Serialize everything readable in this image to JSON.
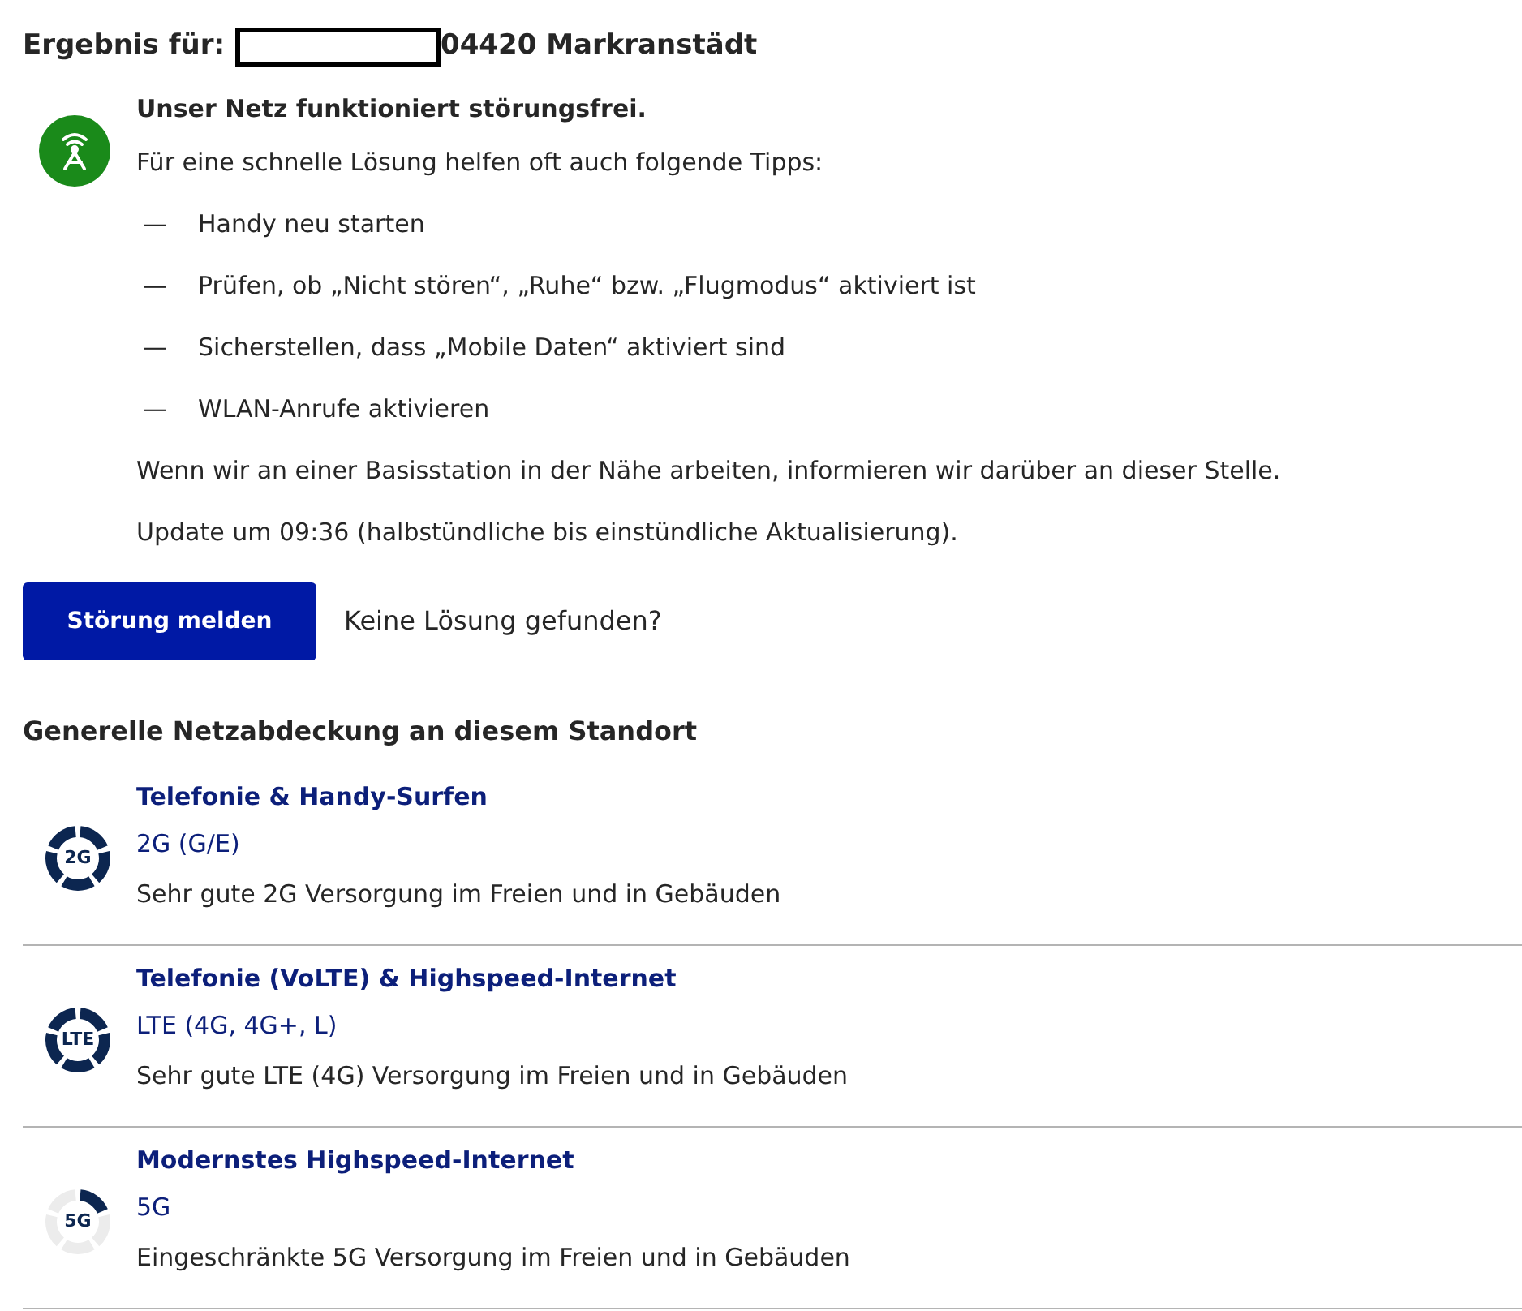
{
  "result": {
    "label": "Ergebnis für:",
    "location": "04420 Markranstädt"
  },
  "status": {
    "title": "Unser Netz funktioniert störungsfrei.",
    "intro": "Für eine schnelle Lösung helfen oft auch folgende Tipps:",
    "tips": [
      {
        "bullet": "—",
        "text": "Handy neu starten"
      },
      {
        "bullet": "—",
        "text": "Prüfen, ob „Nicht stören“, „Ruhe“ bzw. „Flugmodus“ aktiviert ist"
      },
      {
        "bullet": "—",
        "text": "Sicherstellen, dass „Mobile Daten“ aktiviert sind"
      },
      {
        "bullet": "—",
        "text": "WLAN-Anrufe aktivieren"
      }
    ],
    "notes": [
      "Wenn wir an einer Basisstation in der Nähe arbeiten, informieren wir darüber an dieser Stelle.",
      "Update um 09:36 (halbstündliche bis einstündliche Aktualisierung)."
    ]
  },
  "actions": {
    "button": "Störung melden",
    "hint": "Keine Lösung gefunden?"
  },
  "coverage": {
    "heading": "Generelle Netzabdeckung an diesem Standort",
    "items": [
      {
        "badge": "2G",
        "kind": "full",
        "title": "Telefonie & Handy-Surfen",
        "technology": "2G (G/E)",
        "description": "Sehr gute 2G Versorgung im Freien und in Gebäuden"
      },
      {
        "badge": "LTE",
        "kind": "full",
        "title": "Telefonie (VoLTE) & Highspeed-Internet",
        "technology": "LTE (4G, 4G+, L)",
        "description": "Sehr gute LTE (4G) Versorgung im Freien und in Gebäuden"
      },
      {
        "badge": "5G",
        "kind": "limited",
        "title": "Modernstes Highspeed-Internet",
        "technology": "5G",
        "description": "Eingeschränkte 5G Versorgung im Freien und in Gebäuden"
      }
    ]
  }
}
